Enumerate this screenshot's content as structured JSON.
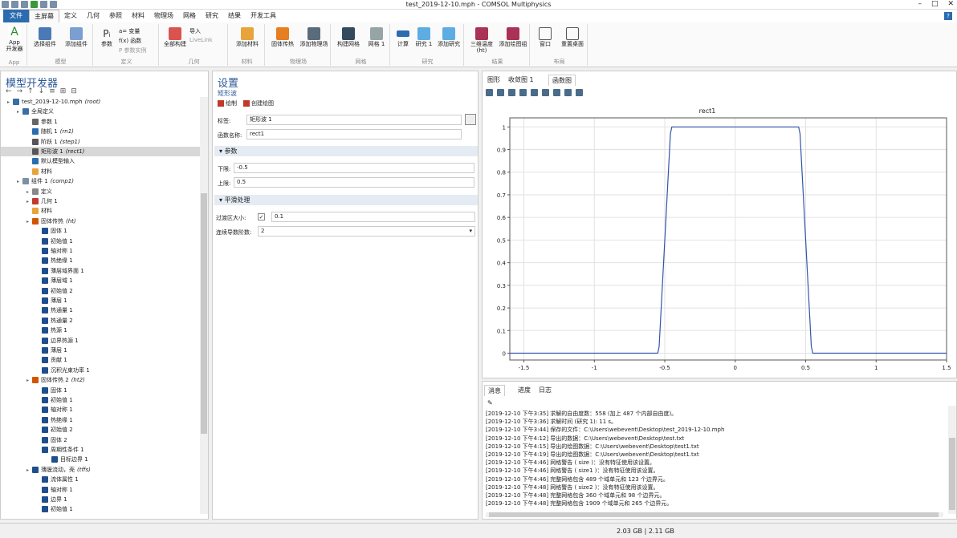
{
  "window": {
    "title": "test_2019-12-10.mph - COMSOL Multiphysics"
  },
  "menu": {
    "file": "文件",
    "tabs": [
      "主屏幕",
      "定义",
      "几何",
      "参照",
      "材料",
      "物理场",
      "网格",
      "研究",
      "结果",
      "开发工具"
    ]
  },
  "ribbon": {
    "groups": [
      {
        "label": "App",
        "buttons": [
          "App\n开发器"
        ]
      },
      {
        "label": "模型",
        "buttons": [
          "选择组件",
          "添加组件"
        ]
      },
      {
        "label": "定义",
        "buttons": [
          "参数"
        ],
        "small": [
          "a= 变量",
          "f(x) 函数",
          "P 参数实例"
        ]
      },
      {
        "label": "几何",
        "buttons": [
          "全部构建"
        ],
        "small": [
          "导入",
          "LiveLink"
        ]
      },
      {
        "label": "材料",
        "buttons": [
          "添加材料"
        ]
      },
      {
        "label": "物理场",
        "buttons": [
          "固体传热",
          "添加物理场"
        ]
      },
      {
        "label": "网格",
        "buttons": [
          "构建网格",
          "网格 1"
        ]
      },
      {
        "label": "研究",
        "buttons": [
          "计算",
          "研究 1",
          "添加研究"
        ]
      },
      {
        "label": "结果",
        "buttons": [
          "三维温度 (ht)",
          "添加绘图组"
        ]
      },
      {
        "label": "布局",
        "buttons": [
          "窗口",
          "重置桌面"
        ]
      }
    ]
  },
  "left_panel": {
    "title": "模型开发器",
    "tree": [
      {
        "label": "test_2019-12-10.mph",
        "suffix": "(root)",
        "depth": 0,
        "icon": "model-icon"
      },
      {
        "label": "全局定义",
        "suffix": "",
        "depth": 1,
        "icon": "globe-icon"
      },
      {
        "label": "参数 1",
        "suffix": "",
        "depth": 2,
        "icon": "param-icon"
      },
      {
        "label": "随机 1",
        "suffix": "(rn1)",
        "depth": 2,
        "icon": "random-icon"
      },
      {
        "label": "阶跃 1",
        "suffix": "(step1)",
        "depth": 2,
        "icon": "step-icon"
      },
      {
        "label": "矩形波 1",
        "suffix": "(rect1)",
        "depth": 2,
        "icon": "rect-icon",
        "selected": true
      },
      {
        "label": "默认模型输入",
        "suffix": "",
        "depth": 2,
        "icon": "input-icon"
      },
      {
        "label": "材料",
        "suffix": "",
        "depth": 2,
        "icon": "material-icon"
      },
      {
        "label": "组件 1",
        "suffix": "(comp1)",
        "depth": 1,
        "icon": "component-icon"
      },
      {
        "label": "定义",
        "suffix": "",
        "depth": 2,
        "icon": "definitions-icon"
      },
      {
        "label": "几何 1",
        "suffix": "",
        "depth": 2,
        "icon": "geometry-icon"
      },
      {
        "label": "材料",
        "suffix": "",
        "depth": 2,
        "icon": "material-icon"
      },
      {
        "label": "固体传热",
        "suffix": "(ht)",
        "depth": 2,
        "icon": "heat-icon"
      },
      {
        "label": "固体 1",
        "suffix": "",
        "depth": 3,
        "icon": "node-icon"
      },
      {
        "label": "初始值 1",
        "suffix": "",
        "depth": 3,
        "icon": "node-icon"
      },
      {
        "label": "轴对称 1",
        "suffix": "",
        "depth": 3,
        "icon": "node-icon"
      },
      {
        "label": "热绝缘 1",
        "suffix": "",
        "depth": 3,
        "icon": "node-icon"
      },
      {
        "label": "薄层域界面 1",
        "suffix": "",
        "depth": 3,
        "icon": "node-icon"
      },
      {
        "label": "薄层域 1",
        "suffix": "",
        "depth": 3,
        "icon": "node-icon"
      },
      {
        "label": "初始值 2",
        "suffix": "",
        "depth": 3,
        "icon": "node-icon"
      },
      {
        "label": "薄层 1",
        "suffix": "",
        "depth": 3,
        "icon": "node-icon"
      },
      {
        "label": "热通量 1",
        "suffix": "",
        "depth": 3,
        "icon": "node-icon"
      },
      {
        "label": "热通量 2",
        "suffix": "",
        "depth": 3,
        "icon": "node-icon"
      },
      {
        "label": "热源 1",
        "suffix": "",
        "depth": 3,
        "icon": "node-icon"
      },
      {
        "label": "边界热源 1",
        "suffix": "",
        "depth": 3,
        "icon": "node-icon"
      },
      {
        "label": "薄层 1",
        "suffix": "",
        "depth": 3,
        "icon": "node-icon"
      },
      {
        "label": "贡献 1",
        "suffix": "",
        "depth": 3,
        "icon": "node-icon"
      },
      {
        "label": "沉积光束功率 1",
        "suffix": "",
        "depth": 3,
        "icon": "node-icon"
      },
      {
        "label": "固体传热 2",
        "suffix": "(ht2)",
        "depth": 2,
        "icon": "heat-icon"
      },
      {
        "label": "固体 1",
        "suffix": "",
        "depth": 3,
        "icon": "node-icon"
      },
      {
        "label": "初始值 1",
        "suffix": "",
        "depth": 3,
        "icon": "node-icon"
      },
      {
        "label": "轴对称 1",
        "suffix": "",
        "depth": 3,
        "icon": "node-icon"
      },
      {
        "label": "热绝缘 1",
        "suffix": "",
        "depth": 3,
        "icon": "node-icon"
      },
      {
        "label": "初始值 2",
        "suffix": "",
        "depth": 3,
        "icon": "node-icon"
      },
      {
        "label": "固体 2",
        "suffix": "",
        "depth": 3,
        "icon": "node-icon"
      },
      {
        "label": "周期性条件 1",
        "suffix": "",
        "depth": 3,
        "icon": "node-icon"
      },
      {
        "label": "目标边界 1",
        "suffix": "",
        "depth": 4,
        "icon": "node-icon"
      },
      {
        "label": "薄膜流动，壳",
        "suffix": "(tffs)",
        "depth": 2,
        "icon": "flow-icon"
      },
      {
        "label": "流体属性 1",
        "suffix": "",
        "depth": 3,
        "icon": "node-icon"
      },
      {
        "label": "轴对称 1",
        "suffix": "",
        "depth": 3,
        "icon": "node-icon"
      },
      {
        "label": "边界 1",
        "suffix": "",
        "depth": 3,
        "icon": "node-icon"
      },
      {
        "label": "初始值 1",
        "suffix": "",
        "depth": 3,
        "icon": "node-icon"
      }
    ]
  },
  "settings": {
    "title": "设置",
    "subtitle": "矩形波",
    "actions": [
      "绘制",
      "创建绘图"
    ],
    "label_caption": "标签:",
    "label_value": "矩形波 1",
    "fname_caption": "函数名称:",
    "fname_value": "rect1",
    "sec_params": "参数",
    "lower_caption": "下限:",
    "lower_value": "-0.5",
    "upper_caption": "上限:",
    "upper_value": "0.5",
    "sec_smooth": "平滑处理",
    "zone_caption": "过渡区大小:",
    "zone_value": "0.1",
    "zone_checked": "✓",
    "deriv_caption": "连续导数阶数:",
    "deriv_value": "2"
  },
  "graphics": {
    "tabs": [
      "图形",
      "收敛图 1",
      "函数图"
    ],
    "active_tab": "函数图"
  },
  "chart_data": {
    "type": "line",
    "title": "rect1",
    "xlabel": "",
    "ylabel": "",
    "xlim": [
      -1.6,
      1.5
    ],
    "ylim": [
      -0.03,
      1.04
    ],
    "xticks": [
      "-1.5",
      "-1",
      "-0.5",
      "0",
      "0.5",
      "1",
      "1.5"
    ],
    "xtick_values": [
      -1.5,
      -1,
      -0.5,
      0,
      0.5,
      1,
      1.5
    ],
    "yticks": [
      "0",
      "0.1",
      "0.2",
      "0.3",
      "0.4",
      "0.5",
      "0.6",
      "0.7",
      "0.8",
      "0.9",
      "1"
    ],
    "ytick_values": [
      0,
      0.1,
      0.2,
      0.3,
      0.4,
      0.5,
      0.6,
      0.7,
      0.8,
      0.9,
      1
    ],
    "series": [
      {
        "x": [
          -1.6,
          -0.55,
          -0.54,
          -0.5,
          -0.46,
          -0.45,
          0.45,
          0.46,
          0.5,
          0.54,
          0.55,
          1.5
        ],
        "values": [
          0,
          0,
          0.03,
          0.5,
          0.97,
          1,
          1,
          0.97,
          0.5,
          0.03,
          0,
          0
        ],
        "color": "#3355aa"
      }
    ],
    "grid": true
  },
  "messages": {
    "tabs": [
      "消息",
      "进度",
      "日志"
    ],
    "lines": [
      "[2019-12-10 下午3:35] 求解的自由度数：558 (加上 487 个内部自由度)。",
      "[2019-12-10 下午3:36] 求解时间 (研究 1): 11 s。",
      "[2019-12-10 下午3:44] 保存的文件：C:\\Users\\webevent\\Desktop\\test_2019-12-10.mph",
      "[2019-12-10 下午4:12] 导出的数据：C:\\Users\\webevent\\Desktop\\test.txt",
      "[2019-12-10 下午4:15] 导出的绘图数据：C:\\Users\\webevent\\Desktop\\test1.txt",
      "[2019-12-10 下午4:19] 导出的绘图数据：C:\\Users\\webevent\\Desktop\\test1.txt",
      "[2019-12-10 下午4:46] 网格警告 ( size )：没有特征使用该设置。",
      "[2019-12-10 下午4:46] 网格警告 ( size1 )：没有特征使用该设置。",
      "[2019-12-10 下午4:46] 完整网格包含 489 个域单元和 123 个边界元。",
      "[2019-12-10 下午4:48] 网格警告 ( size2 )：没有特征使用该设置。",
      "[2019-12-10 下午4:48] 完整网格包含 360 个域单元和 98 个边界元。",
      "[2019-12-10 下午4:48] 完整网格包含 1909 个域单元和 265 个边界元。"
    ]
  },
  "status": {
    "memory": "2.03 GB | 2.11 GB"
  }
}
